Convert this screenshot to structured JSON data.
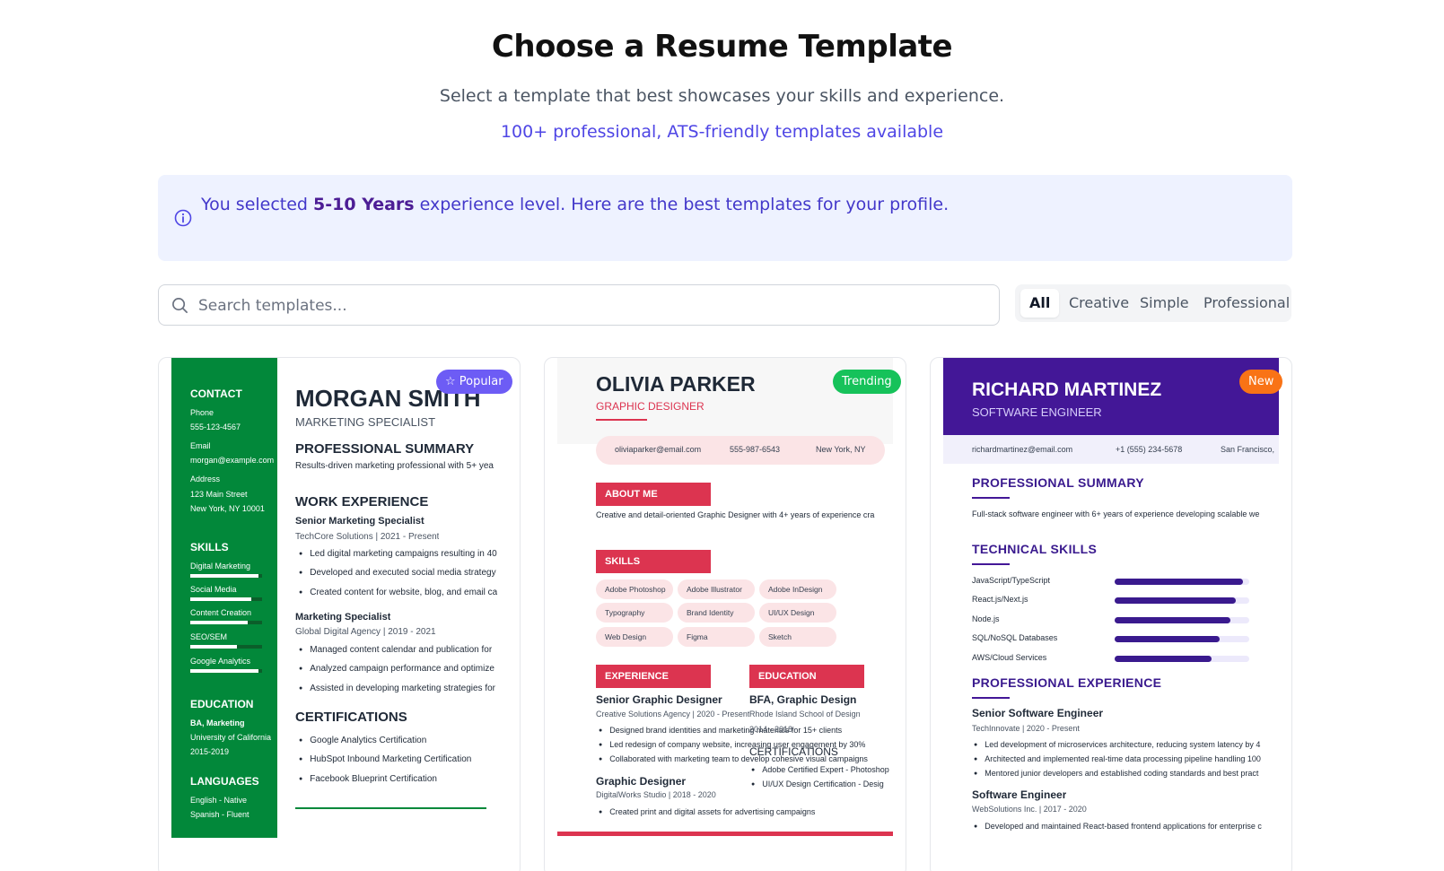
{
  "header": {
    "title": "Choose a Resume Template",
    "subtitle": "Select a template that best showcases your skills and experience.",
    "tagline": "100+ professional, ATS-friendly templates available"
  },
  "banner": {
    "prefix": "You selected ",
    "level": "5-10 Years",
    "suffix": " experience level. Here are the best templates for your profile."
  },
  "search": {
    "placeholder": "Search templates..."
  },
  "filters": [
    "All",
    "Creative",
    "Simple",
    "Professional"
  ],
  "colors": {
    "accent": "#4f46e5",
    "popular": "#6d5cf5",
    "trending": "#16c25a",
    "new": "#f97316",
    "green_template": "#02883a",
    "red_template": "#dc3450",
    "purple_template": "#431797"
  },
  "cards": [
    {
      "badge": "Popular",
      "badge_icon": "star-icon",
      "sidebar": {
        "contact_heading": "CONTACT",
        "phone_label": "Phone",
        "phone": "555-123-4567",
        "email_label": "Email",
        "email": "morgan@example.com",
        "address_label": "Address",
        "address1": "123 Main Street",
        "address2": "New York, NY 10001",
        "skills_heading": "SKILLS",
        "skills": [
          {
            "name": "Digital Marketing",
            "level": 0.95
          },
          {
            "name": "Social Media",
            "level": 0.85
          },
          {
            "name": "Content Creation",
            "level": 0.8
          },
          {
            "name": "SEO/SEM",
            "level": 0.65
          },
          {
            "name": "Google Analytics",
            "level": 0.95
          }
        ],
        "education_heading": "EDUCATION",
        "degree": "BA, Marketing",
        "school": "University of California",
        "years": "2015-2019",
        "languages_heading": "LANGUAGES",
        "lang1": "English - Native",
        "lang2": "Spanish - Fluent"
      },
      "name": "MORGAN SMITH",
      "role": "MARKETING SPECIALIST",
      "summary_heading": "PROFESSIONAL SUMMARY",
      "summary": "Results-driven marketing professional with 5+ yea",
      "work_heading": "WORK EXPERIENCE",
      "job1_title": "Senior Marketing Specialist",
      "job1_meta": "TechCore Solutions | 2021 - Present",
      "job1_bullets": [
        "Led digital marketing campaigns resulting in 40",
        "Developed and executed social media strategy",
        "Created content for website, blog, and email ca"
      ],
      "job2_title": "Marketing Specialist",
      "job2_meta": "Global Digital Agency | 2019 - 2021",
      "job2_bullets": [
        "Managed content calendar and publication for",
        "Analyzed campaign performance and optimize",
        "Assisted in developing marketing strategies for"
      ],
      "cert_heading": "CERTIFICATIONS",
      "certs": [
        "Google Analytics Certification",
        "HubSpot Inbound Marketing Certification",
        "Facebook Blueprint Certification"
      ]
    },
    {
      "badge": "Trending",
      "name": "OLIVIA PARKER",
      "role": "GRAPHIC DESIGNER",
      "email": "oliviaparker@email.com",
      "phone": "555-987-6543",
      "location": "New York, NY",
      "about_heading": "ABOUT ME",
      "about": "Creative and detail-oriented Graphic Designer with 4+ years of experience cra",
      "skills_heading": "SKILLS",
      "skills": [
        "Adobe Photoshop",
        "Adobe Illustrator",
        "Adobe InDesign",
        "Typography",
        "Brand Identity",
        "UI/UX Design",
        "Web Design",
        "Figma",
        "Sketch"
      ],
      "experience_heading": "EXPERIENCE",
      "job1_title": "Senior Graphic Designer",
      "job1_meta": "Creative Solutions Agency | 2020 - Present",
      "job1_bullets": [
        "Designed brand identities and marketing materials for 15+ clients",
        "Led redesign of company website, increasing user engagement by 30%",
        "Collaborated with marketing team to develop cohesive visual campaigns"
      ],
      "job2_title": "Graphic Designer",
      "job2_meta": "DigitalWorks Studio | 2018 - 2020",
      "job2_bullets": [
        "Created print and digital assets for advertising campaigns"
      ],
      "education_heading": "EDUCATION",
      "degree": "BFA, Graphic Design",
      "school": "Rhode Island School of Design",
      "edu_years": "2014 - 2018",
      "cert_heading": "CERTIFICATIONS",
      "certs": [
        "Adobe Certified Expert - Photoshop",
        "UI/UX Design Certification - Desig"
      ]
    },
    {
      "badge": "New",
      "name": "RICHARD MARTINEZ",
      "role": "SOFTWARE ENGINEER",
      "email": "richardmartinez@email.com",
      "phone": "+1 (555) 234-5678",
      "location": "San Francisco,",
      "summary_heading": "PROFESSIONAL SUMMARY",
      "summary": "Full-stack software engineer with 6+ years of experience developing scalable we",
      "skills_heading": "TECHNICAL SKILLS",
      "skills": [
        {
          "name": "JavaScript/TypeScript",
          "level": 0.95
        },
        {
          "name": "React.js/Next.js",
          "level": 0.9
        },
        {
          "name": "Node.js",
          "level": 0.86
        },
        {
          "name": "SQL/NoSQL Databases",
          "level": 0.78
        },
        {
          "name": "AWS/Cloud Services",
          "level": 0.72
        }
      ],
      "experience_heading": "PROFESSIONAL EXPERIENCE",
      "job1_title": "Senior Software Engineer",
      "job1_meta": "TechInnovate | 2020 - Present",
      "job1_bullets": [
        "Led development of microservices architecture, reducing system latency by 4",
        "Architected and implemented real-time data processing pipeline handling 100",
        "Mentored junior developers and established coding standards and best pract"
      ],
      "job2_title": "Software Engineer",
      "job2_meta": "WebSolutions Inc. | 2017 - 2020",
      "job2_bullets": [
        "Developed and maintained React-based frontend applications for enterprise c"
      ]
    }
  ]
}
